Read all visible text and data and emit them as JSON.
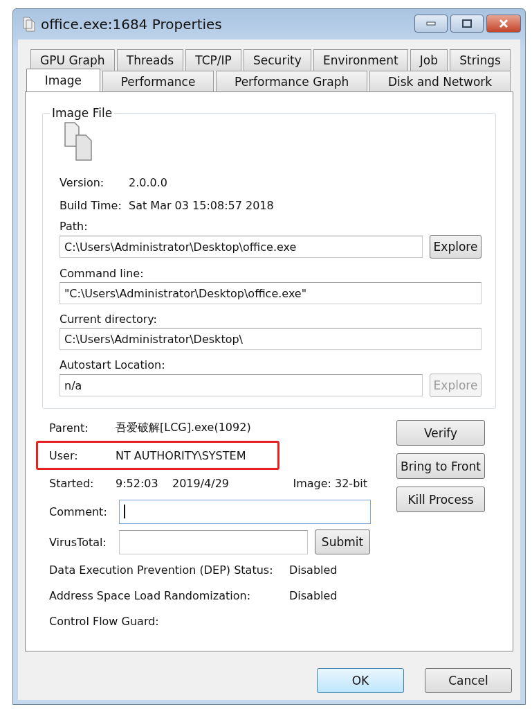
{
  "window": {
    "title": "office.exe:1684 Properties"
  },
  "tab_rows": [
    [
      {
        "label": "GPU Graph",
        "selected": false
      },
      {
        "label": "Threads",
        "selected": false
      },
      {
        "label": "TCP/IP",
        "selected": false
      },
      {
        "label": "Security",
        "selected": false
      },
      {
        "label": "Environment",
        "selected": false
      },
      {
        "label": "Job",
        "selected": false
      },
      {
        "label": "Strings",
        "selected": false
      }
    ],
    [
      {
        "label": "Image",
        "selected": true
      },
      {
        "label": "Performance",
        "selected": false
      },
      {
        "label": "Performance Graph",
        "selected": false
      },
      {
        "label": "Disk and Network",
        "selected": false
      }
    ]
  ],
  "image_file": {
    "legend": "Image File",
    "version": {
      "label": "Version:",
      "value": "2.0.0.0"
    },
    "build_time": {
      "label": "Build Time:",
      "value": "Sat Mar 03 15:08:57 2018"
    },
    "fields": [
      {
        "label": "Path:",
        "value": "C:\\Users\\Administrator\\Desktop\\office.exe",
        "button": {
          "label": "Explore",
          "disabled": false
        }
      },
      {
        "label": "Command line:",
        "value": "\"C:\\Users\\Administrator\\Desktop\\office.exe\""
      },
      {
        "label": "Current directory:",
        "value": "C:\\Users\\Administrator\\Desktop\\"
      },
      {
        "label": "Autostart Location:",
        "value": "n/a",
        "button": {
          "label": "Explore",
          "disabled": true
        }
      }
    ]
  },
  "process": {
    "parent": {
      "label": "Parent:",
      "value": "吾爱破解[LCG].exe(1092)"
    },
    "user": {
      "label": "User:",
      "value": "NT AUTHORITY\\SYSTEM",
      "highlighted": true
    },
    "started": {
      "label": "Started:",
      "time": "9:52:03",
      "date": "2019/4/29",
      "image": "Image: 32-bit"
    },
    "comment": {
      "label": "Comment:",
      "focused": true
    },
    "virustotal": {
      "label": "VirusTotal:",
      "button": "Submit"
    },
    "flags": [
      {
        "label": "Data Execution Prevention (DEP) Status:",
        "value": "Disabled"
      },
      {
        "label": "Address Space Load Randomization:",
        "value": "Disabled"
      },
      {
        "label": "Control Flow Guard:"
      }
    ]
  },
  "side_buttons": [
    "Verify",
    "Bring to Front",
    "Kill Process"
  ],
  "dialog_buttons": [
    {
      "label": "OK",
      "default": true
    },
    {
      "label": "Cancel",
      "default": false
    }
  ]
}
